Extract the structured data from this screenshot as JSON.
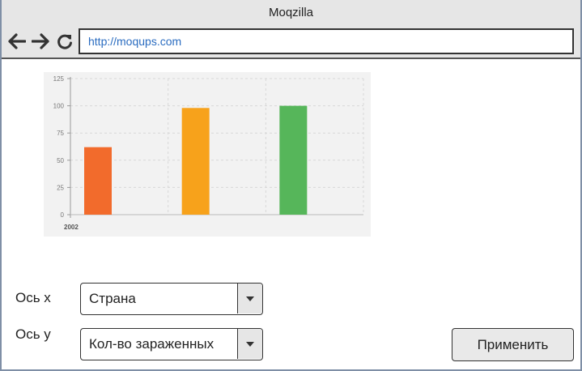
{
  "browser": {
    "title": "Moqzilla",
    "url": "http://moqups.com"
  },
  "icons": {
    "back": "arrow-left-icon",
    "forward": "arrow-right-icon",
    "reload": "reload-icon",
    "dropdown": "chevron-down-icon"
  },
  "form": {
    "x_axis_label": "Ось x",
    "x_axis_value": "Страна",
    "y_axis_label": "Ось y",
    "y_axis_value": "Кол-во зараженных",
    "apply_label": "Применить"
  },
  "chart_data": {
    "type": "bar",
    "categories": [
      "2002"
    ],
    "series": [
      {
        "values": [
          62
        ],
        "color": "#f26b2c"
      },
      {
        "values": [
          98
        ],
        "color": "#f7a21b"
      },
      {
        "values": [
          100
        ],
        "color": "#56b65a"
      }
    ],
    "title": "",
    "xlabel": "",
    "ylabel": "",
    "ylim": [
      0,
      125
    ],
    "yticks": [
      0,
      25,
      50,
      75,
      100,
      125
    ],
    "grid": true
  }
}
